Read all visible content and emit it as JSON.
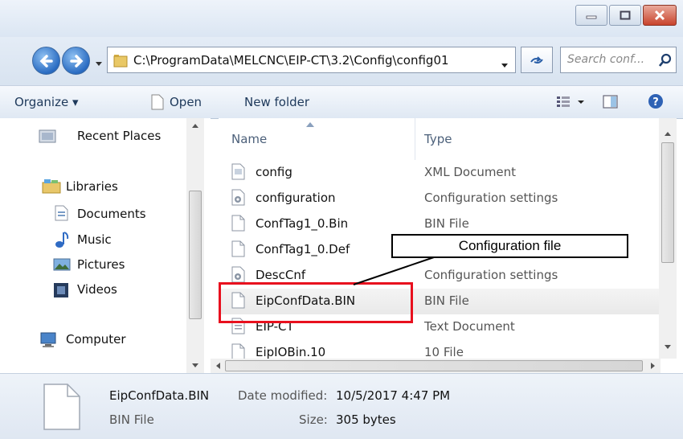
{
  "window": {
    "caption_buttons": [
      "minimize-icon",
      "maximize-icon",
      "close-icon"
    ]
  },
  "address_bar": {
    "path": "C:\\ProgramData\\MELCNC\\EIP-CT\\3.2\\Config\\config01",
    "search_placeholder": "Search conf..."
  },
  "toolbar": {
    "organize": "Organize ▾",
    "open": "Open",
    "new_folder": "New folder"
  },
  "nav": {
    "recent_places": "Recent Places",
    "libraries": "Libraries",
    "documents": "Documents",
    "music": "Music",
    "pictures": "Pictures",
    "videos": "Videos",
    "computer": "Computer"
  },
  "columns": {
    "name": "Name",
    "type": "Type"
  },
  "files": [
    {
      "name": "config",
      "type": "XML Document",
      "icon": "xml-file-icon"
    },
    {
      "name": "configuration",
      "type": "Configuration settings",
      "icon": "settings-file-icon"
    },
    {
      "name": "ConfTag1_0.Bin",
      "type": "BIN File",
      "icon": "blank-file-icon"
    },
    {
      "name": "ConfTag1_0.Def",
      "type": "",
      "icon": "blank-file-icon"
    },
    {
      "name": "DescCnf",
      "type": "Configuration settings",
      "icon": "settings-file-icon"
    },
    {
      "name": "EipConfData.BIN",
      "type": "BIN File",
      "icon": "blank-file-icon",
      "selected": true
    },
    {
      "name": "EIP-CT",
      "type": "Text Document",
      "icon": "text-file-icon"
    },
    {
      "name": "EipIOBin.10",
      "type": "10 File",
      "icon": "blank-file-icon"
    }
  ],
  "details": {
    "file_name": "EipConfData.BIN",
    "file_type": "BIN File",
    "date_label": "Date modified:",
    "date_value": "10/5/2017 4:47 PM",
    "size_label": "Size:",
    "size_value": "305 bytes"
  },
  "annotation": {
    "callout_text": "Configuration file",
    "highlight_color": "#e8101e"
  }
}
